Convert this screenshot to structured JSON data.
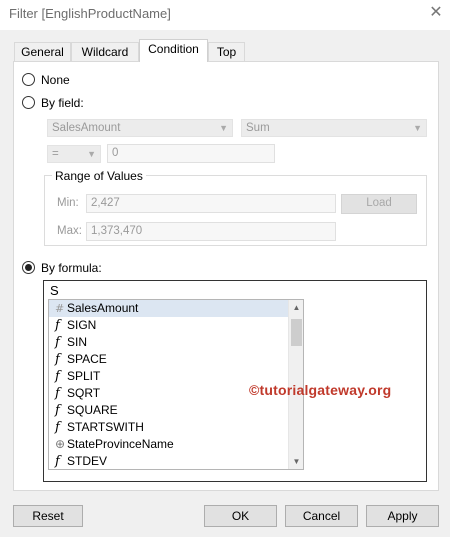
{
  "window": {
    "title": "Filter [EnglishProductName]",
    "close_glyph": "✕"
  },
  "tabs": [
    {
      "label": "General"
    },
    {
      "label": "Wildcard"
    },
    {
      "label": "Condition"
    },
    {
      "label": "Top"
    }
  ],
  "active_tab": "Condition",
  "options": {
    "none_label": "None",
    "by_field_label": "By field:",
    "by_formula_label": "By formula:",
    "selected": "By formula"
  },
  "by_field": {
    "field": "SalesAmount",
    "aggregation": "Sum",
    "operator": "=",
    "value": "0"
  },
  "range": {
    "label": "Range of Values",
    "min_label": "Min:",
    "min_value": "2,427",
    "max_label": "Max:",
    "max_value": "1,373,470",
    "load_label": "Load"
  },
  "formula": {
    "typed_text": "S",
    "autocomplete": [
      {
        "icon": "#",
        "icon_name": "measure-icon",
        "text": "SalesAmount",
        "selected": true
      },
      {
        "icon": "f",
        "icon_name": "function-icon",
        "text": "SIGN"
      },
      {
        "icon": "f",
        "icon_name": "function-icon",
        "text": "SIN"
      },
      {
        "icon": "f",
        "icon_name": "function-icon",
        "text": "SPACE"
      },
      {
        "icon": "f",
        "icon_name": "function-icon",
        "text": "SPLIT"
      },
      {
        "icon": "f",
        "icon_name": "function-icon",
        "text": "SQRT"
      },
      {
        "icon": "f",
        "icon_name": "function-icon",
        "text": "SQUARE"
      },
      {
        "icon": "f",
        "icon_name": "function-icon",
        "text": "STARTSWITH"
      },
      {
        "icon": "⊕",
        "icon_name": "geo-icon",
        "text": "StateProvinceName"
      },
      {
        "icon": "f",
        "icon_name": "function-icon",
        "text": "STDEV"
      }
    ]
  },
  "watermark": "©tutorialgateway.org",
  "buttons": {
    "reset": "Reset",
    "ok": "OK",
    "cancel": "Cancel",
    "apply": "Apply"
  },
  "colors": {
    "watermark": "#c0392b",
    "selection": "#dce6f2"
  }
}
